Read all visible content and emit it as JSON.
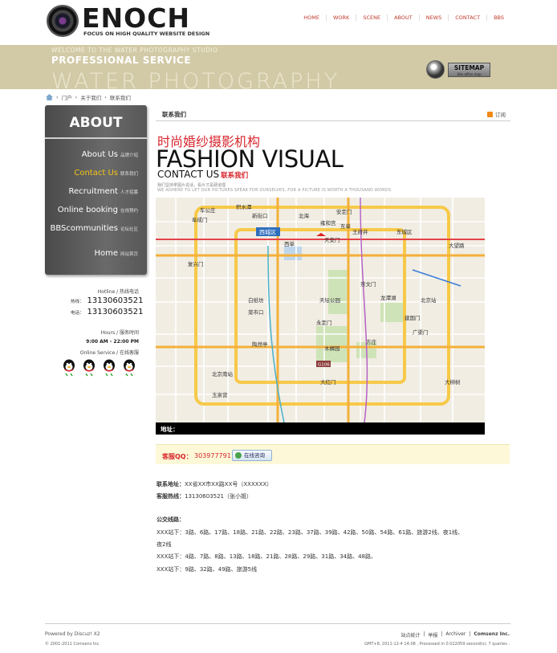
{
  "header": {
    "logo_text": "ENOCH",
    "tagline": "FOCUS ON HIGH QUALITY WEBSITE DESIGN",
    "nav": [
      "HOME",
      "WORK",
      "SCENE",
      "ABOUT",
      "NEWS",
      "CONTACT",
      "BBS"
    ]
  },
  "banner": {
    "welcome": "WELCOME TO THE WATER PHOTOGRAPHY STUDIO",
    "service": "PROFESSIONAL SERVICE",
    "water": "WATER PHOTOGRAPHY",
    "sitemap_label": "SITEMAP",
    "sitemap_sub": "Site office map"
  },
  "breadcrumb": {
    "home": "门户",
    "sep": "›",
    "about": "关于我们",
    "current": "联系我们"
  },
  "sidebar": {
    "title": "ABOUT",
    "items": [
      {
        "label": "About Us",
        "sub": "品牌介绍",
        "active": false
      },
      {
        "label": "Contact Us",
        "sub": "联系我们",
        "active": true
      },
      {
        "label": "Recruitment",
        "sub": "人才招募",
        "active": false
      },
      {
        "label": "Online booking",
        "sub": "在线预约",
        "active": false
      },
      {
        "label": "BBScommunities",
        "sub": "论坛社区",
        "active": false
      },
      {
        "label": "Home",
        "sub": "网站首页",
        "active": false
      }
    ]
  },
  "contact": {
    "hotline_label": "Hotline / 热线电话",
    "phone1_key": "热线：",
    "phone1": "13130603521",
    "phone2_key": "电话：",
    "phone2": "13130603521",
    "hours_label": "Hours / 服务时间",
    "hours": "9:00 AM - 22:00 PM",
    "online_label": "Online Service / 在线客服",
    "qq_icons": [
      "qq-penguin-icon",
      "qq-penguin-icon",
      "qq-penguin-icon",
      "qq-penguin-icon"
    ]
  },
  "main": {
    "title": "联系我们",
    "rss": "订阅",
    "cn_title": "时尚婚纱摄影机构",
    "en_title": "FASHION VISUAL",
    "contact_us": "CONTACT US",
    "contact_us_cn": "联系我们",
    "slogan_cn": "我们坚持拿图片说话，看片才是硬道理",
    "slogan_en": "WE ADHERE TO LET OUR PICTURES SPEAK FOR OURSELVES, FOR A PICTURE IS WORTH A THOUSAND WORDS.",
    "address_bar": "地址：",
    "kf_label": "客服QQ：",
    "kf_num": "303977791",
    "kf_btn": "在线咨询",
    "info": {
      "addr_key": "联系地址：",
      "addr_val": "XX省XX市XX路XX号（XXXXXX）",
      "tel_key": "客服热线：",
      "tel_val": "13130603521（张小姐）",
      "bus_title": "公交线路：",
      "bus1": "XXX站下：3路、6路、17路、18路、21路、22路、23路、37路、39路、42路、50路、54路、61路、旅游2线、夜1线、",
      "bus1b": "夜2线",
      "bus2": "XXX站下：4路、7路、8路、13路、18路、21路、28路、29路、31路、34路、48路、",
      "bus3": "XXX站下：9路、32路、49路、旅游5线"
    }
  },
  "map_labels": [
    "西城区",
    "东城区",
    "北京站",
    "大望路",
    "天安门",
    "王府井",
    "建国门",
    "东单",
    "西单",
    "复兴门",
    "阜成门",
    "车公庄",
    "积水潭",
    "安定门",
    "雍和宫",
    "北海",
    "新街口",
    "天坛公园",
    "龙潭湖",
    "北京南站",
    "陶然亭",
    "木樨园",
    "大红门",
    "永定门",
    "方庄",
    "广渠门",
    "崇文门",
    "菜市口",
    "白纸坊",
    "玉泉营",
    "大柳树",
    "G106"
  ],
  "footer": {
    "powered": "Powered by Discuz! X2",
    "copyright": "© 2001-2011 Comsenz Inc.",
    "links": [
      "站点统计",
      "举报",
      "Archiver",
      "Comsenz Inc."
    ],
    "stats": "GMT+8, 2011-12-4 14:08 , Processed in 0.022059 second(s), 7 queries ."
  }
}
